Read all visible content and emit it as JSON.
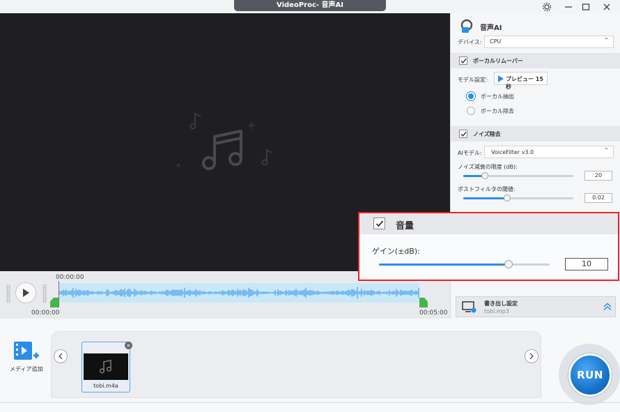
{
  "window": {
    "title": "VideoProc- 音声AI"
  },
  "timeline": {
    "playhead_time": "00:00:00",
    "start_time": "00:00:00",
    "end_time": "00:05:00"
  },
  "panel": {
    "header_title": "音声AI",
    "device_label": "デバイス:",
    "device_value": "CPU",
    "vocal_remover": {
      "title": "ボーカルリムーバー",
      "model_label": "モデル設定:",
      "preview_button": "プレビュー 15秒",
      "options": [
        "ボーカル抽出",
        "ボーカル除去"
      ],
      "selected_index": 0
    },
    "noise": {
      "title": "ノイズ除去",
      "ai_model_label": "AIモデル:",
      "ai_model_value": "VoiceFilter v3.0",
      "reduction_label": "ノイズ減衰の限度 (dB):",
      "reduction_value": "20",
      "postfilter_label": "ポストフィルタの閾値:",
      "postfilter_value": "0.02"
    },
    "export": {
      "title": "書き出し設定",
      "filename": "tobi.mp3"
    }
  },
  "volume": {
    "title": "音量",
    "gain_label": "ゲイン(±dB):",
    "gain_value": "10",
    "gain_fraction": 0.76
  },
  "media": {
    "add_label": "メディア追加",
    "items": [
      {
        "name": "tobi.m4a"
      }
    ]
  },
  "run_label": "RUN",
  "colors": {
    "accent": "#2a8de8",
    "highlight": "#e8232a",
    "marker": "#45b549"
  }
}
